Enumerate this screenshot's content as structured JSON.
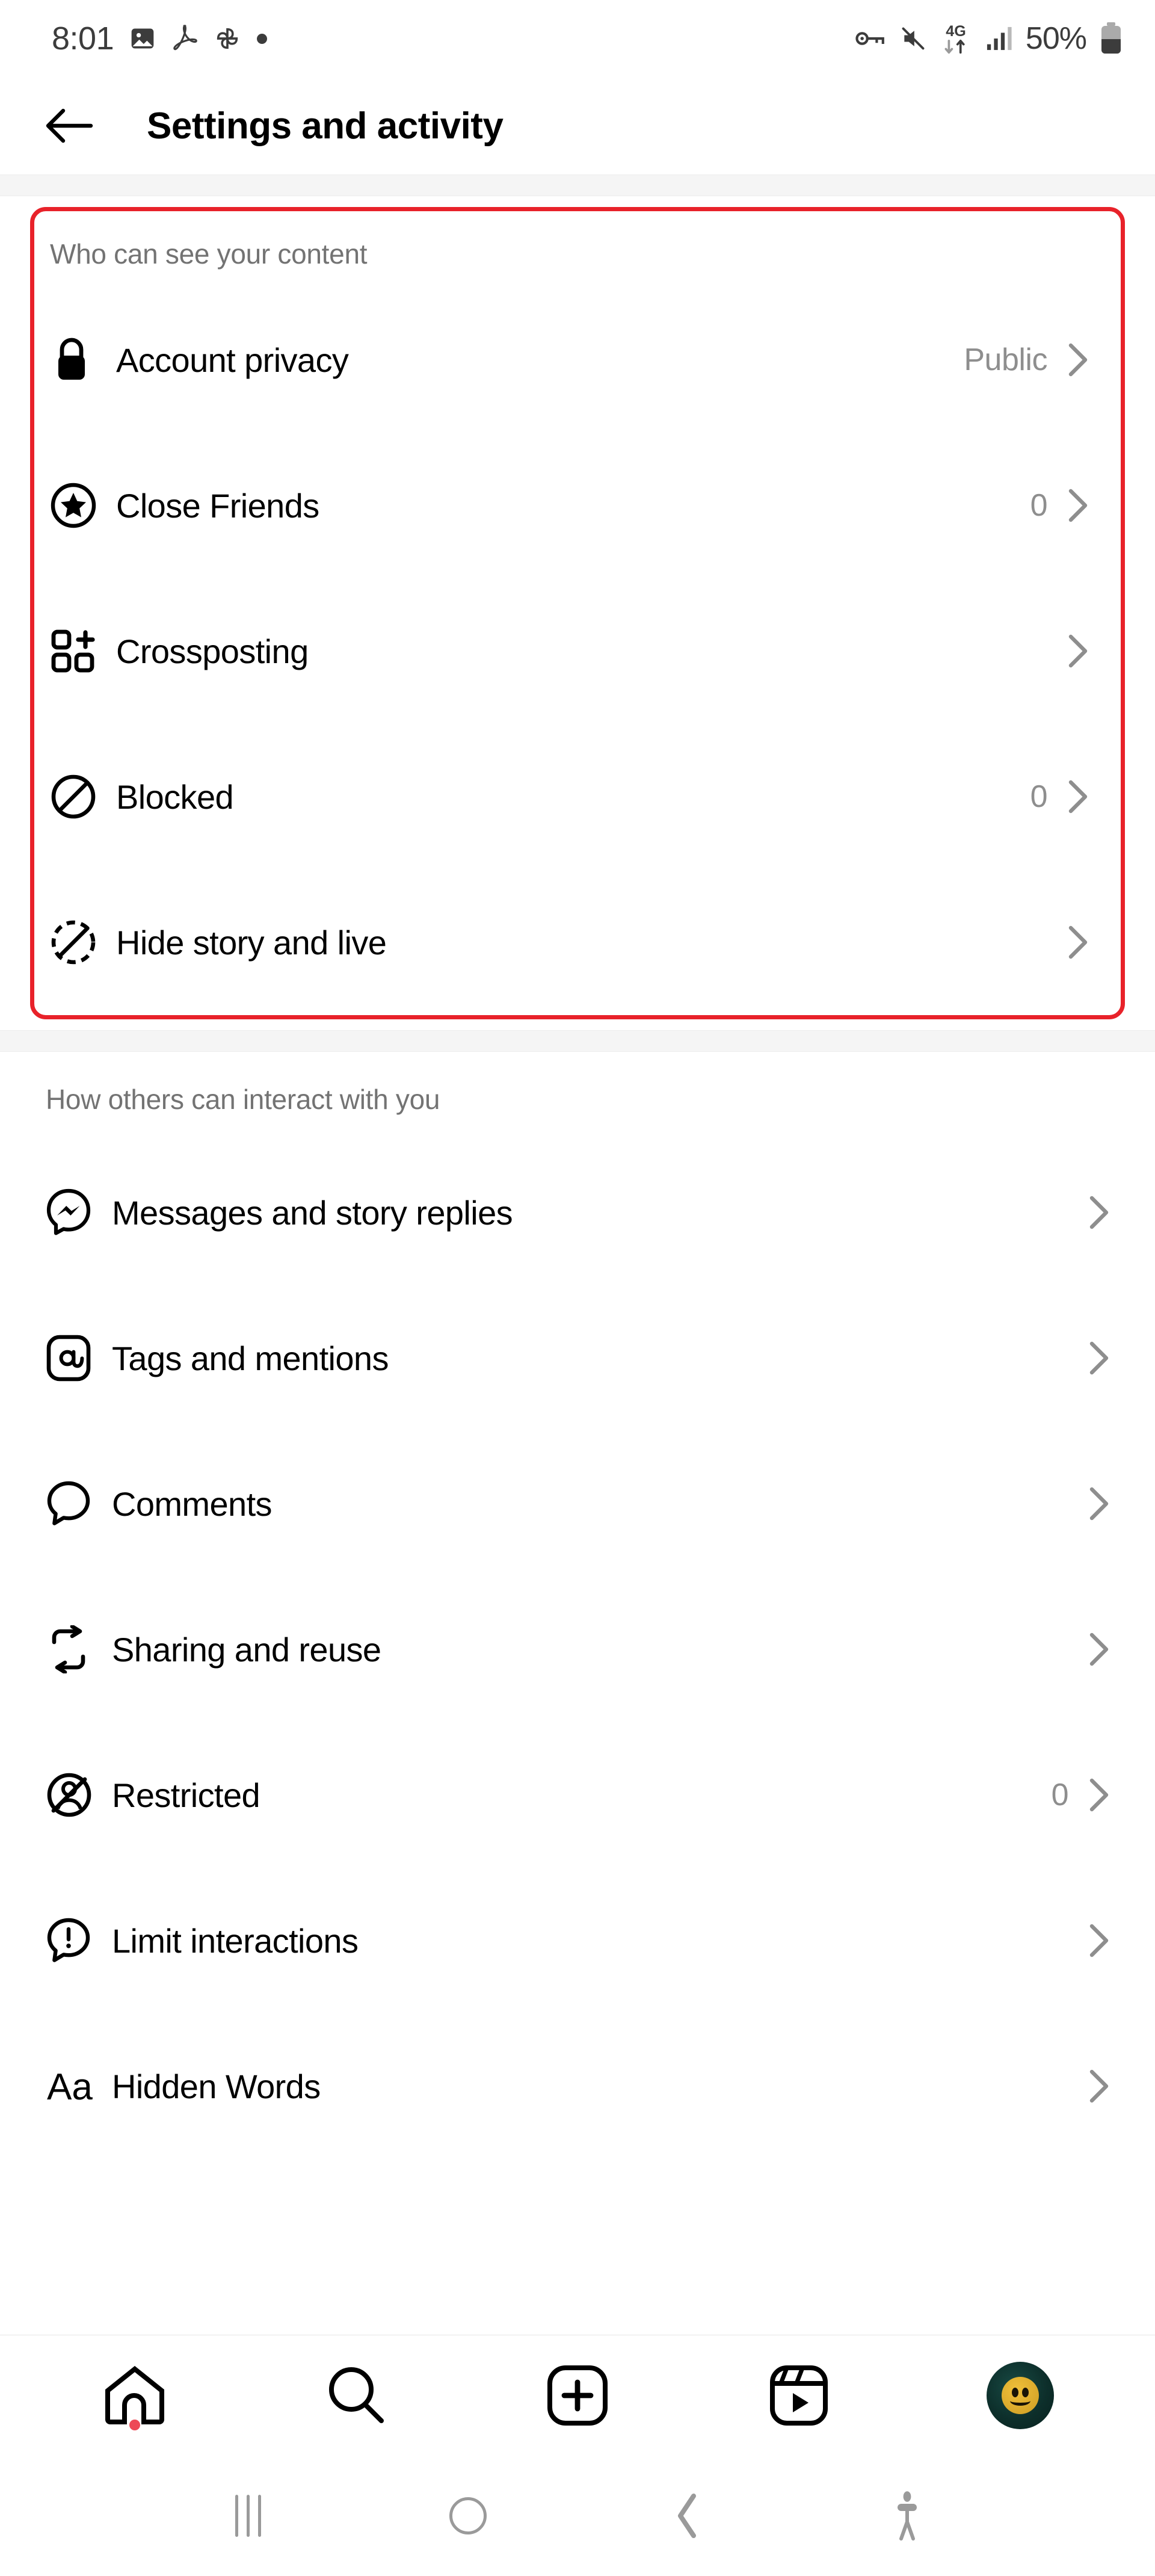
{
  "status_bar": {
    "time": "8:01",
    "battery_percent": "50%",
    "network": "4G",
    "left_icons": [
      "image-icon",
      "pdf-icon",
      "pinwheel-icon",
      "dot-icon"
    ],
    "right_icons": [
      "vpn-key-icon",
      "mute-icon",
      "4g-data-icon",
      "signal-bars-icon",
      "battery-icon"
    ]
  },
  "header": {
    "title": "Settings and activity",
    "back_icon": "back-arrow-icon"
  },
  "sections": [
    {
      "id": "who-can-see-your-content",
      "title": "Who can see your content",
      "highlighted": true,
      "highlight_color": "#e8222a",
      "items": [
        {
          "icon": "lock-icon",
          "label": "Account privacy",
          "value": "Public"
        },
        {
          "icon": "close-friends-icon",
          "label": "Close Friends",
          "value": "0"
        },
        {
          "icon": "crossposting-icon",
          "label": "Crossposting",
          "value": ""
        },
        {
          "icon": "blocked-icon",
          "label": "Blocked",
          "value": "0"
        },
        {
          "icon": "hide-story-icon",
          "label": "Hide story and live",
          "value": ""
        }
      ]
    },
    {
      "id": "how-others-can-interact-with-you",
      "title": "How others can interact with you",
      "highlighted": false,
      "items": [
        {
          "icon": "messenger-icon",
          "label": "Messages and story replies",
          "value": ""
        },
        {
          "icon": "at-icon",
          "label": "Tags and mentions",
          "value": ""
        },
        {
          "icon": "comment-icon",
          "label": "Comments",
          "value": ""
        },
        {
          "icon": "reuse-icon",
          "label": "Sharing and reuse",
          "value": ""
        },
        {
          "icon": "restricted-icon",
          "label": "Restricted",
          "value": "0"
        },
        {
          "icon": "limit-icon",
          "label": "Limit interactions",
          "value": ""
        },
        {
          "icon": "hidden-words-icon",
          "label": "Hidden Words",
          "value": ""
        }
      ]
    }
  ],
  "bottom_nav": [
    {
      "icon": "home-icon",
      "badge": true
    },
    {
      "icon": "search-icon",
      "badge": false
    },
    {
      "icon": "create-icon",
      "badge": false
    },
    {
      "icon": "reels-icon",
      "badge": false
    },
    {
      "icon": "profile-avatar-icon",
      "badge": false
    }
  ],
  "android_nav": [
    {
      "icon": "recents-icon"
    },
    {
      "icon": "home-circle-icon"
    },
    {
      "icon": "back-chevron-icon"
    },
    {
      "icon": "accessibility-icon"
    }
  ],
  "chevron_glyph": "›"
}
